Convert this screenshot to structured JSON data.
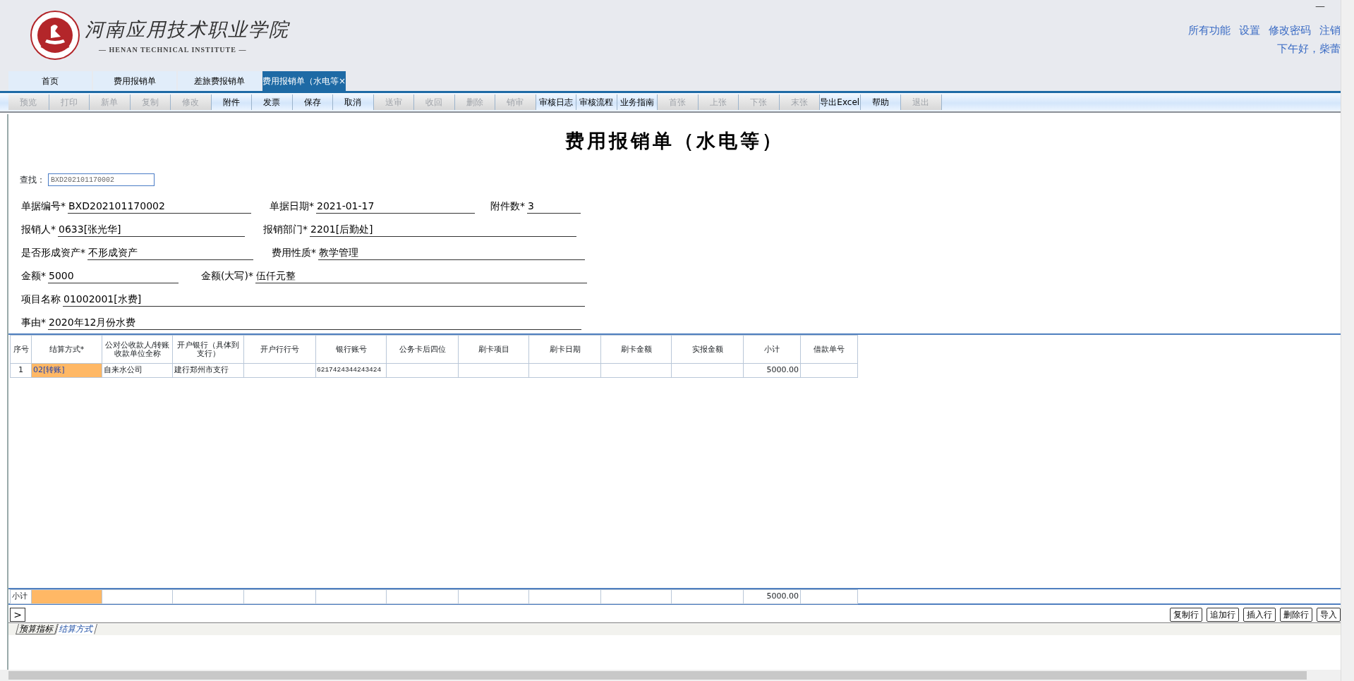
{
  "logo": {
    "name": "河南应用技术职业学院",
    "subtitle": "— HENAN TECHNICAL INSTITUTE —"
  },
  "top_links": [
    "所有功能",
    "设置",
    "修改密码",
    "注销"
  ],
  "greeting": "下午好，柴蕾",
  "window_button": "—",
  "tabs": [
    {
      "label": "首页",
      "selected": false
    },
    {
      "label": "费用报销单",
      "selected": false
    },
    {
      "label": "差旅费报销单",
      "selected": false
    },
    {
      "label": "费用报销单（水电等",
      "selected": true,
      "close": "×"
    }
  ],
  "toolbar": [
    {
      "label": "预览",
      "disabled": true
    },
    {
      "label": "打印",
      "disabled": true
    },
    {
      "label": "新单",
      "disabled": true
    },
    {
      "label": "复制",
      "disabled": true
    },
    {
      "label": "修改",
      "disabled": true
    },
    {
      "label": "附件",
      "disabled": false
    },
    {
      "label": "发票",
      "disabled": false
    },
    {
      "label": "保存",
      "disabled": false
    },
    {
      "label": "取消",
      "disabled": false
    },
    {
      "label": "送审",
      "disabled": true
    },
    {
      "label": "收回",
      "disabled": true
    },
    {
      "label": "删除",
      "disabled": true
    },
    {
      "label": "销审",
      "disabled": true
    },
    {
      "label": "审核日志",
      "disabled": false
    },
    {
      "label": "审核流程",
      "disabled": false
    },
    {
      "label": "业务指南",
      "disabled": false
    },
    {
      "label": "首张",
      "disabled": true
    },
    {
      "label": "上张",
      "disabled": true
    },
    {
      "label": "下张",
      "disabled": true
    },
    {
      "label": "末张",
      "disabled": true
    },
    {
      "label": "导出Excel",
      "disabled": false
    },
    {
      "label": "帮助",
      "disabled": false
    },
    {
      "label": "退出",
      "disabled": true
    }
  ],
  "form_title": "费用报销单（水电等）",
  "search": {
    "label": "查找：",
    "value": "BXD202101170002"
  },
  "form_rows": [
    [
      {
        "label": "单据编号*",
        "value": "BXD202101170002"
      },
      {
        "label": "单据日期*",
        "value": "2021-01-17"
      },
      {
        "label": "附件数*",
        "value": "3"
      }
    ],
    [
      {
        "label": "报销人*",
        "value": "0633[张光华]"
      },
      {
        "label": "报销部门*",
        "value": "2201[后勤处]"
      }
    ],
    [
      {
        "label": "是否形成资产*",
        "value": "不形成资产"
      },
      {
        "label": "费用性质*",
        "value": "教学管理"
      }
    ],
    [
      {
        "label": "金额*",
        "value": "5000"
      },
      {
        "label": "金额(大写)*",
        "value": "伍仟元整"
      }
    ],
    [
      {
        "label": "项目名称",
        "value": "01002001[水费]"
      }
    ],
    [
      {
        "label": "事由*",
        "value": "2020年12月份水费"
      }
    ]
  ],
  "table": {
    "columns": [
      {
        "label": "序号",
        "highlighted": false
      },
      {
        "label": "结算方式*",
        "highlighted": true
      },
      {
        "label": "公对公收款人/转账收款单位全称",
        "highlighted": false
      },
      {
        "label": "开户银行（具体到支行）",
        "highlighted": false
      },
      {
        "label": "开户行行号",
        "highlighted": false
      },
      {
        "label": "银行账号",
        "highlighted": false
      },
      {
        "label": "公务卡后四位",
        "highlighted": false
      },
      {
        "label": "刷卡项目",
        "highlighted": false
      },
      {
        "label": "刷卡日期",
        "highlighted": false
      },
      {
        "label": "刷卡金额",
        "highlighted": false
      },
      {
        "label": "实报金额",
        "highlighted": false
      },
      {
        "label": "小计",
        "highlighted": false
      },
      {
        "label": "借款单号",
        "highlighted": false
      }
    ],
    "rows": [
      [
        "1",
        "02[转账]",
        "自来水公司",
        "建行郑州市支行",
        null,
        "6217424344243424",
        null,
        null,
        null,
        null,
        null,
        "5000.00",
        null
      ]
    ],
    "total": {
      "label": "小计",
      "subtotal": "5000.00"
    }
  },
  "expand_button": ">",
  "row_buttons": [
    "复制行",
    "追加行",
    "插入行",
    "删除行",
    "导入"
  ],
  "bottom_tabs": [
    {
      "label": "预算指标",
      "selected": false
    },
    {
      "label": "结算方式",
      "selected": true
    }
  ]
}
